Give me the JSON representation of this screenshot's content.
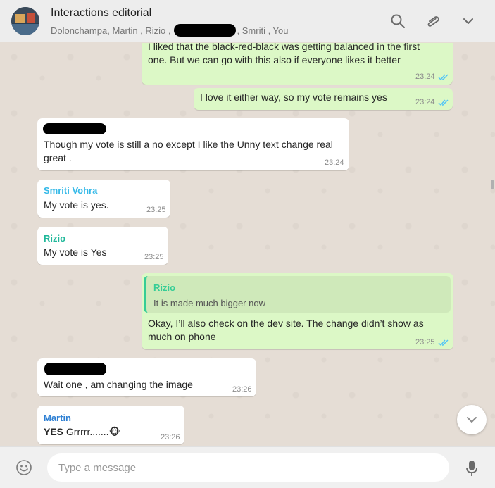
{
  "header": {
    "title": "Interactions editorial",
    "participants_before": "Dolonchampa, Martin , Rizio ,",
    "participants_after": ", Smriti , You",
    "icons": [
      "search-icon",
      "attach-icon",
      "chevron-down-icon"
    ]
  },
  "messages": [
    {
      "direction": "out",
      "text_line1": "I liked that the black-red-black was getting balanced in the first",
      "text_line2": "one. But we can go with this also if everyone likes it better",
      "time": "23:24"
    },
    {
      "direction": "out",
      "text": "I love it either way, so my vote remains yes",
      "time": "23:24"
    },
    {
      "direction": "in",
      "sender_redacted": true,
      "text_line1": "Though my vote is still a no except I like the Unny text change real",
      "text_line2": "great .",
      "time": "23:24"
    },
    {
      "direction": "in",
      "sender": "Smriti Vohra",
      "sender_color": "#35b9e8",
      "text": "My vote is yes.",
      "time": "23:25"
    },
    {
      "direction": "in",
      "sender": "Rizio",
      "sender_color": "#1fb89a",
      "text": "My vote is Yes",
      "time": "23:25"
    },
    {
      "direction": "out",
      "quote_author": "Rizio",
      "quote_text": "It is made much bigger now",
      "text_line1": "Okay, I’ll also check on the dev site. The change didn’t show as",
      "text_line2": "much on phone",
      "time": "23:25"
    },
    {
      "direction": "in",
      "sender_redacted": true,
      "text": "Wait one , am changing the image",
      "time": "23:26"
    },
    {
      "direction": "in",
      "sender": "Martin",
      "sender_color": "#2d7fd3",
      "text_bold": "YES",
      "text_rest": " Grrrrr.......",
      "emoji": "🐵",
      "time": "23:26"
    }
  ],
  "composer": {
    "placeholder": "Type a message"
  },
  "colors": {
    "outgoing_bubble": "#dcf8c6",
    "incoming_bubble": "#ffffff",
    "read_ticks": "#4fc3f7",
    "chat_background": "#e5ddd5"
  }
}
